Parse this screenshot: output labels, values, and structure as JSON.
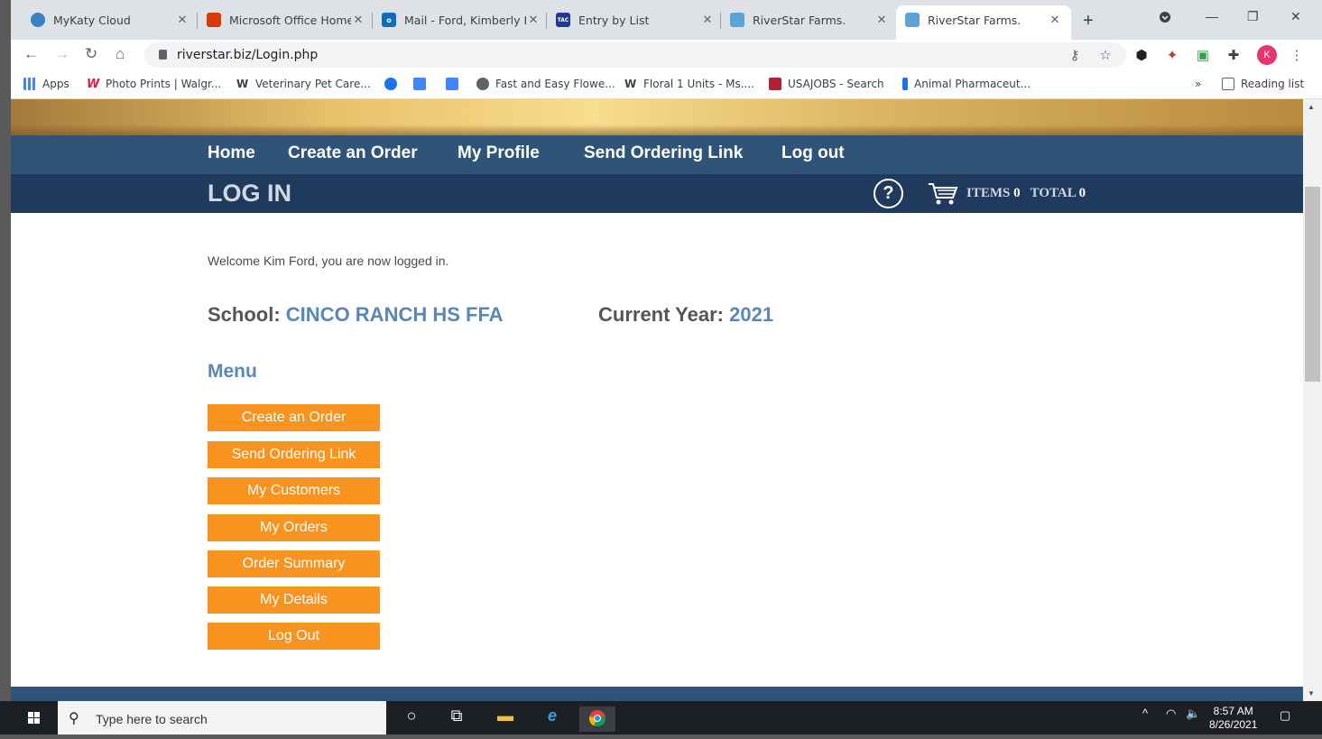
{
  "browser": {
    "tabs": [
      {
        "title": "MyKaty Cloud",
        "favicon_color": "#3b82c4"
      },
      {
        "title": "Microsoft Office Home",
        "favicon_color": "#d83b01"
      },
      {
        "title": "Mail - Ford, Kimberly L",
        "favicon_color": "#0f6cbd"
      },
      {
        "title": "Entry by List",
        "favicon_color": "#1f3a8a"
      },
      {
        "title": "RiverStar Farms.",
        "favicon_color": "#5aa5d6"
      },
      {
        "title": "RiverStar Farms.",
        "favicon_color": "#5aa5d6",
        "active": true
      }
    ],
    "url": "riverstar.biz/Login.php",
    "avatar_letter": "K",
    "bookmarks": [
      {
        "label": "Apps",
        "color": "#4285f4"
      },
      {
        "label": "Photo Prints | Walgr...",
        "color": "#e31837"
      },
      {
        "label": "Veterinary Pet Care...",
        "color": "#222222"
      },
      {
        "label": "",
        "color": "#1a73e8"
      },
      {
        "label": "",
        "color": "#4285f4"
      },
      {
        "label": "",
        "color": "#4285f4"
      },
      {
        "label": "Fast and Easy Flowe...",
        "color": "#5f6368"
      },
      {
        "label": "Floral 1 Units - Ms....",
        "color": "#222222"
      },
      {
        "label": "USAJOBS - Search",
        "color": "#b22234"
      },
      {
        "label": "Animal Pharmaceut...",
        "color": "#1a73e8"
      }
    ],
    "reading_list": "Reading list"
  },
  "site": {
    "nav": [
      "Home",
      "Create an Order",
      "My Profile",
      "Send Ordering Link",
      "Log out"
    ],
    "page_title": "LOG IN",
    "help_symbol": "?",
    "cart": {
      "items_label": "ITEMS",
      "items_value": "0",
      "total_label": "TOTAL",
      "total_value": "0"
    },
    "welcome": "Welcome Kim Ford, you are now logged in.",
    "school_label": "School:",
    "school_value": "CINCO RANCH HS FFA",
    "year_label": "Current Year:",
    "year_value": "2021",
    "menu_heading": "Menu",
    "menu_items": [
      "Create an Order",
      "Send Ordering Link",
      "My Customers",
      "My Orders",
      "Order Summary",
      "My Details",
      "Log Out"
    ],
    "accent_orange": "#f7931e",
    "nav_blue": "#2f5478"
  },
  "taskbar": {
    "search_placeholder": "Type here to search",
    "time": "8:57 AM",
    "date": "8/26/2021"
  }
}
